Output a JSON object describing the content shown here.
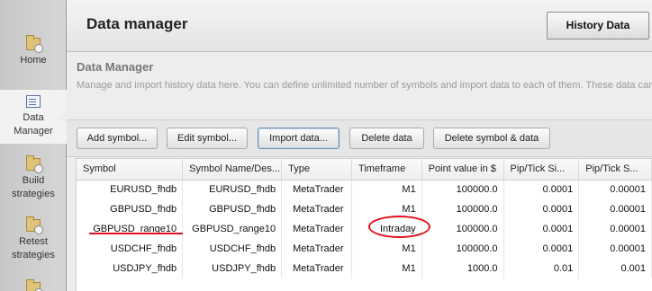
{
  "sidebar": {
    "items": [
      {
        "label": "Home",
        "icon": "home-folder-icon"
      },
      {
        "label": "Data Manager",
        "icon": "data-manager-document-icon"
      },
      {
        "label": "Build strategies",
        "icon": "build-strategies-folder-icon"
      },
      {
        "label": "Retest strategies",
        "icon": "retest-strategies-folder-icon"
      },
      {
        "label": "",
        "icon": "folder-icon"
      }
    ],
    "active_index": 1
  },
  "header": {
    "title": "Data manager",
    "history_tab_label": "History Data"
  },
  "section": {
    "title": "Data Manager",
    "description": "Manage and import history data here. You can define unlimited number of symbols and import data to each of them. These data can b"
  },
  "toolbar": {
    "add_symbol": "Add symbol...",
    "edit_symbol": "Edit symbol...",
    "import_data": "Import data...",
    "delete_data": "Delete data",
    "delete_symbol_data": "Delete symbol & data"
  },
  "table": {
    "columns": [
      "Symbol",
      "Symbol Name/Des...",
      "Type",
      "Timeframe",
      "Point value in $",
      "Pip/Tick Si...",
      "Pip/Tick S..."
    ],
    "rows": [
      [
        "EURUSD_fhdb",
        "EURUSD_fhdb",
        "MetaTrader",
        "M1",
        "100000.0",
        "0.0001",
        "0.00001"
      ],
      [
        "GBPUSD_fhdb",
        "GBPUSD_fhdb",
        "MetaTrader",
        "M1",
        "100000.0",
        "0.0001",
        "0.00001"
      ],
      [
        "GBPUSD_range10",
        "GBPUSD_range10",
        "MetaTrader",
        "Intraday",
        "100000.0",
        "0.0001",
        "0.00001"
      ],
      [
        "USDCHF_fhdb",
        "USDCHF_fhdb",
        "MetaTrader",
        "M1",
        "100000.0",
        "0.0001",
        "0.00001"
      ],
      [
        "USDJPY_fhdb",
        "USDJPY_fhdb",
        "MetaTrader",
        "M1",
        "1000.0",
        "0.01",
        "0.001"
      ]
    ]
  },
  "annotations": {
    "highlight_color": "#e0101a"
  }
}
